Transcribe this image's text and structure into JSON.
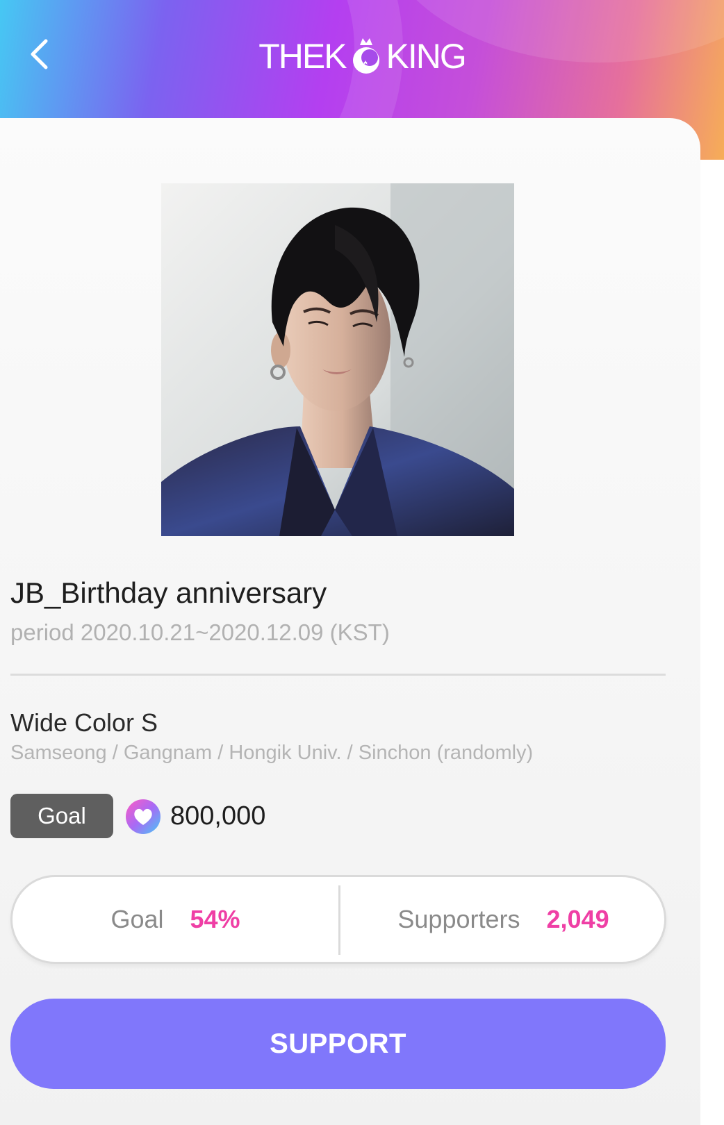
{
  "header": {
    "back_icon": "chevron-left-icon",
    "logo_left": "THEK",
    "logo_right": "KING"
  },
  "campaign": {
    "title": "JB_Birthday anniversary",
    "period": "period 2020.10.21~2020.12.09 (KST)"
  },
  "product": {
    "name": "Wide Color S",
    "location": "Samseong / Gangnam / Hongik Univ. / Sinchon (randomly)"
  },
  "goal": {
    "badge_label": "Goal",
    "icon": "heart-icon",
    "amount": "800,000"
  },
  "stats": {
    "goal_label": "Goal",
    "goal_value": "54%",
    "supporters_label": "Supporters",
    "supporters_value": "2,049"
  },
  "actions": {
    "support_label": "SUPPORT"
  },
  "colors": {
    "accent_pink": "#ef3fa5",
    "button_purple": "#8077fb",
    "badge_gray": "#5f5f5f"
  }
}
